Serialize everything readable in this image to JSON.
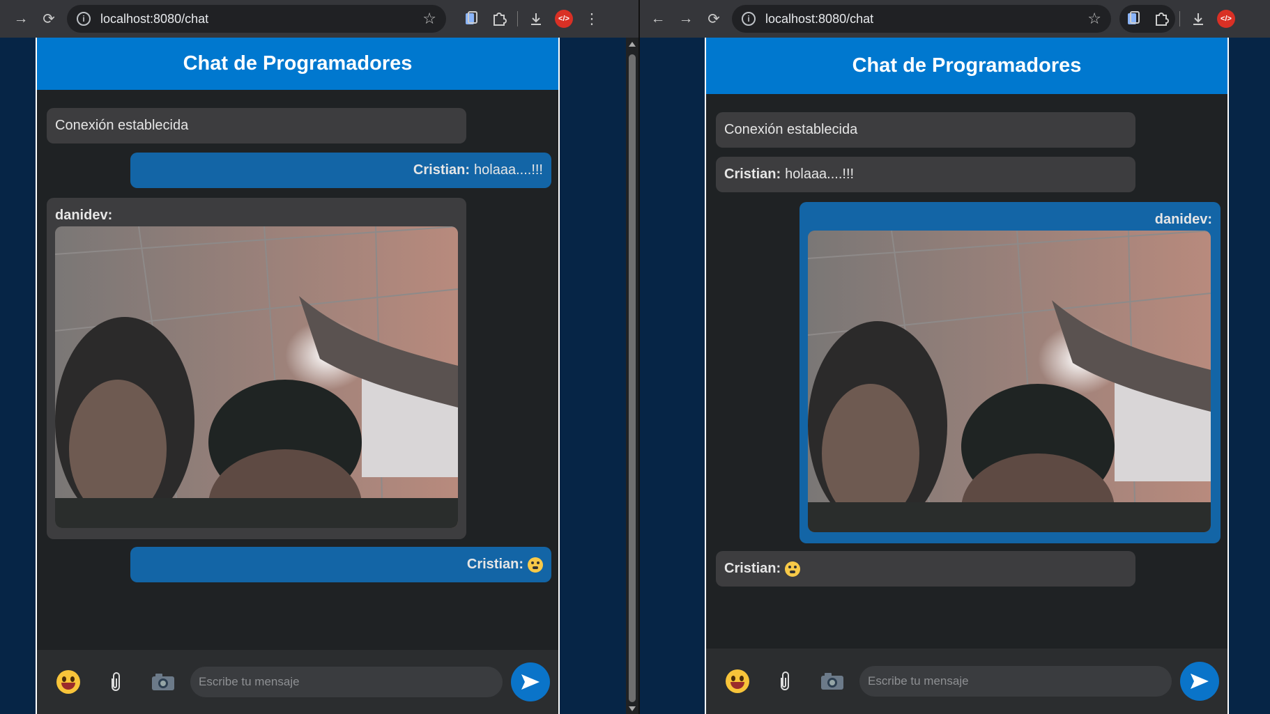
{
  "left_window": {
    "url": "localhost:8080/chat",
    "app": {
      "title": "Chat de Programadores",
      "messages": [
        {
          "kind": "system",
          "text": "Conexión establecida"
        },
        {
          "kind": "own",
          "sender": "Cristian:",
          "text": "holaaa....!!!"
        },
        {
          "kind": "image",
          "side": "other",
          "sender": "danidev:"
        },
        {
          "kind": "own",
          "sender": "Cristian:",
          "emoji": "grimacing-face-icon"
        }
      ],
      "composer": {
        "placeholder": "Escribe tu mensaje"
      }
    }
  },
  "right_window": {
    "url": "localhost:8080/chat",
    "app": {
      "title": "Chat de Programadores",
      "messages": [
        {
          "kind": "system",
          "text": "Conexión establecida"
        },
        {
          "kind": "other",
          "sender": "Cristian:",
          "text": "holaaa....!!!"
        },
        {
          "kind": "image",
          "side": "own",
          "sender": "danidev:"
        },
        {
          "kind": "other",
          "sender": "Cristian:",
          "emoji": "grimacing-face-icon"
        }
      ],
      "composer": {
        "placeholder": "Escribe tu mensaje"
      }
    }
  },
  "colors": {
    "header": "#0078cf",
    "own_bubble": "#1365a6",
    "other_bubble": "#3d3d3f",
    "chat_bg": "#1f2224",
    "send_button": "#0a74c9"
  }
}
